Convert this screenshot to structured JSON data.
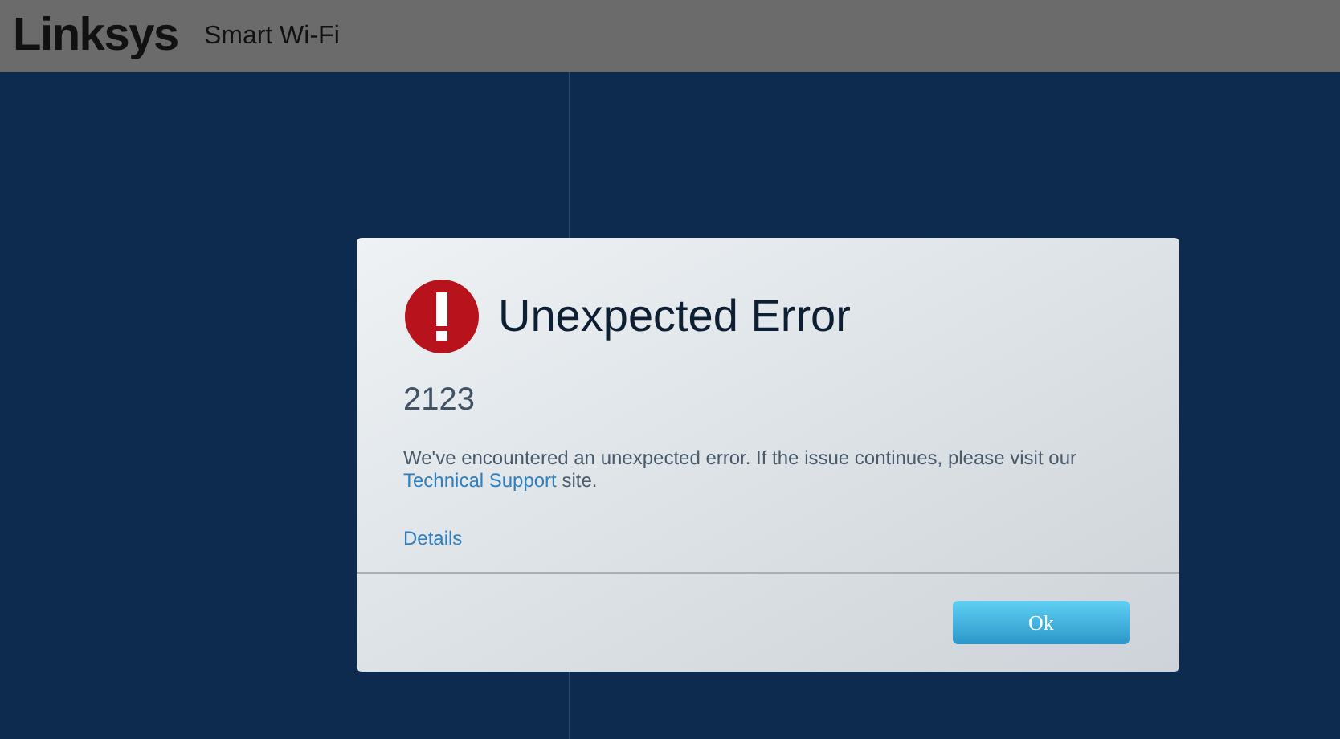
{
  "header": {
    "logo": "Linksys",
    "product": "Smart Wi-Fi"
  },
  "dialog": {
    "title": "Unexpected Error",
    "code": "2123",
    "message": "We've encountered an unexpected error. If the issue continues, please visit our",
    "link": "Technical Support",
    "message_end": "site.",
    "details": "Details",
    "button": "Ok"
  }
}
